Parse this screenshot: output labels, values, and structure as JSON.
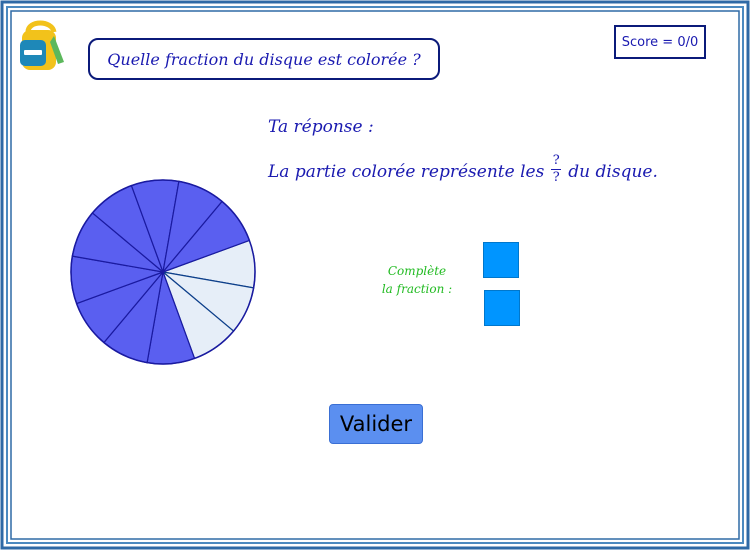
{
  "question": "Quelle fraction du disque est colorée ?",
  "score": "Score = 0/0",
  "answer": {
    "title": "Ta réponse :",
    "sentence_before": "La partie colorée représente les",
    "numerator": "?",
    "denominator": "?",
    "sentence_after": "du disque."
  },
  "hint": {
    "line1": "Complète",
    "line2": "la fraction :"
  },
  "submit_label": "Valider",
  "disc": {
    "total_parts": 12,
    "colored_parts": 9,
    "colored_fill": "#5a5ff0",
    "uncolored_fill": "#e6eef8"
  },
  "colors": {
    "text_blue": "#1a1ab0",
    "hint_green": "#22bb22",
    "input_blue": "#0095ff",
    "button_blue": "#5b8ff0"
  },
  "icons": {
    "logo": "backpack-icon"
  }
}
